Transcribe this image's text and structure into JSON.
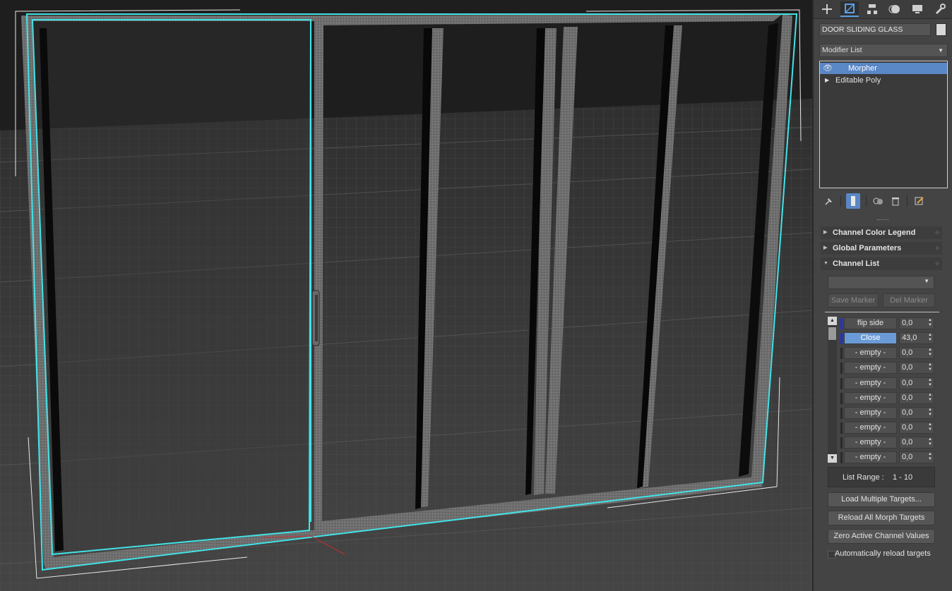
{
  "object_name": "DOOR SLIDING GLASS",
  "modifier_list": "Modifier List",
  "stack": [
    {
      "label": "Morpher",
      "selected": true
    },
    {
      "label": "Editable Poly",
      "selected": false
    }
  ],
  "rollouts": {
    "channel_color_legend": "Channel Color Legend",
    "global_parameters": "Global Parameters",
    "channel_list": "Channel List"
  },
  "buttons": {
    "save_marker": "Save Marker",
    "del_marker": "Del Marker",
    "load_multiple": "Load Multiple Targets...",
    "reload_all": "Reload All Morph Targets",
    "zero_active": "Zero Active Channel Values"
  },
  "channels": [
    {
      "name": "flip side",
      "value": "0,0",
      "active": true,
      "selected": false
    },
    {
      "name": "Close",
      "value": "43,0",
      "active": true,
      "selected": true
    },
    {
      "name": "- empty -",
      "value": "0,0",
      "active": false,
      "selected": false
    },
    {
      "name": "- empty -",
      "value": "0,0",
      "active": false,
      "selected": false
    },
    {
      "name": "- empty -",
      "value": "0,0",
      "active": false,
      "selected": false
    },
    {
      "name": "- empty -",
      "value": "0,0",
      "active": false,
      "selected": false
    },
    {
      "name": "- empty -",
      "value": "0,0",
      "active": false,
      "selected": false
    },
    {
      "name": "- empty -",
      "value": "0,0",
      "active": false,
      "selected": false
    },
    {
      "name": "- empty -",
      "value": "0,0",
      "active": false,
      "selected": false
    },
    {
      "name": "- empty -",
      "value": "0,0",
      "active": false,
      "selected": false
    }
  ],
  "list_range": {
    "label": "List Range :",
    "value": "1 - 10"
  },
  "auto_reload": {
    "label": "Automatically reload targets",
    "checked": false
  },
  "tabs": [
    "create-icon",
    "modify-icon",
    "hierarchy-icon",
    "motion-icon",
    "display-icon",
    "utilities-icon"
  ],
  "colors": {
    "selection": "#42e3e8",
    "highlight": "#5a87c5",
    "channel_active": "#1f32d6"
  }
}
